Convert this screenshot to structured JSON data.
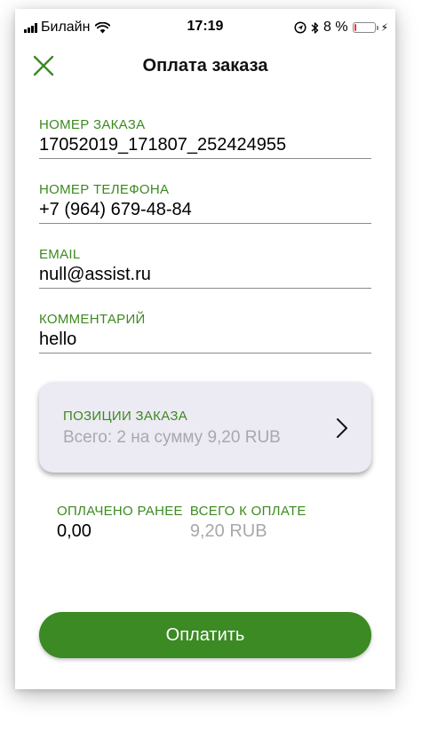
{
  "status_bar": {
    "carrier": "Билайн",
    "time": "17:19",
    "battery_percent": "8 %",
    "battery_level": 0.08,
    "battery_color": "#ff2d2d",
    "charging_glyph": "⚡"
  },
  "header": {
    "title": "Оплата заказа"
  },
  "fields": {
    "order_number": {
      "label": "НОМЕР ЗАКАЗА",
      "value": "17052019_171807_252424955"
    },
    "phone": {
      "label": "НОМЕР ТЕЛЕФОНА",
      "value": "+7 (964) 679-48-84"
    },
    "email": {
      "label": "EMAIL",
      "value": "null@assist.ru"
    },
    "comment": {
      "label": "КОММЕНТАРИЙ",
      "value": "hello"
    }
  },
  "order_items": {
    "label": "ПОЗИЦИИ ЗАКАЗА",
    "summary": "Всего: 2 на сумму 9,20 RUB"
  },
  "totals": {
    "paid_label": "ОПЛАЧЕНО РАНЕЕ",
    "paid_value": "0,00",
    "due_label": "ВСЕГО К ОПЛАТЕ",
    "due_value": "9,20 RUB"
  },
  "pay_button": {
    "label": "Оплатить"
  },
  "colors": {
    "accent": "#3b8a23",
    "label_green": "#3c8a1f",
    "card_bg": "#eceaf3",
    "muted_text": "#a8a8ad"
  },
  "icons": {
    "signal": "signal-icon",
    "wifi": "wifi-icon",
    "location": "location-icon",
    "bluetooth": "bluetooth-icon",
    "battery": "battery-icon",
    "charging": "charging-icon",
    "close": "close-icon",
    "chevron": "chevron-right-icon"
  }
}
